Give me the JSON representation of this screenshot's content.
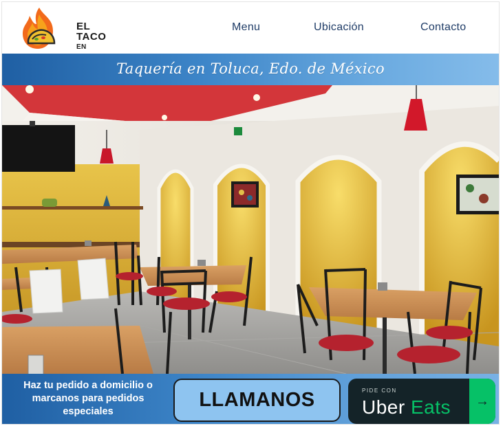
{
  "logo": {
    "line1": "EL TACO",
    "line2": "EN LLAMAS",
    "icon": "flame-taco-logo"
  },
  "nav": {
    "items": [
      "Menu",
      "Ubicación",
      "Contacto"
    ],
    "color": "#1e3b66"
  },
  "banner": {
    "text": "Taquería en Toluca, Edo. de México"
  },
  "hero": {
    "icon": "restaurant-interior-photo"
  },
  "bottom_bar": {
    "message": "Haz tu pedido a domicilio o marcanos para pedidos especiales",
    "call_label": "LLAMANOS",
    "uber": {
      "small": "PIDE CON",
      "brand_1": "Uber",
      "brand_2": "Eats",
      "arrow": "→"
    }
  },
  "colors": {
    "accent_blue": "#1f5fa3",
    "button_blue": "#8ec4f0",
    "uber_dark": "#142328",
    "uber_green": "#06c167"
  }
}
